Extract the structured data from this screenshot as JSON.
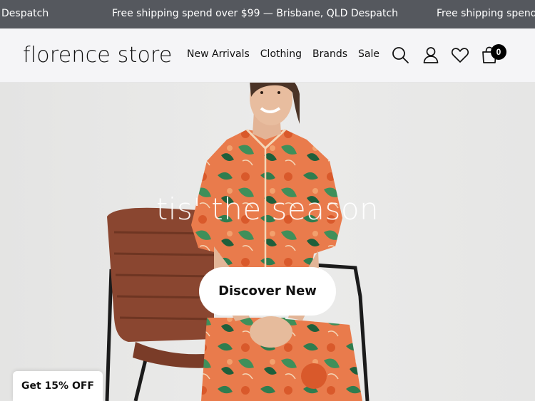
{
  "announcement": {
    "segment_left": "Despatch",
    "segment_main": "Free shipping spend over $99 — Brisbane, QLD Despatch",
    "segment_right": "Free shipping spend o"
  },
  "header": {
    "logo": "florence store",
    "nav": [
      "New Arrivals",
      "Clothing",
      "Brands",
      "Sale"
    ],
    "icons": [
      "search-icon",
      "account-icon",
      "wishlist-heart-icon",
      "cart-bag-icon"
    ],
    "cart_count": "0"
  },
  "hero": {
    "heading": "tis' the season",
    "cta_label": "Discover New"
  },
  "promo": {
    "label": "Get 15% OFF"
  },
  "colors": {
    "announcement_bg": "#55585e",
    "header_bg": "#f5f5f7",
    "hero_bg": "#e8e8e7",
    "pajama_orange": "#e7774a",
    "leaf_green": "#2f7d4f",
    "chair_leather": "#8a4630"
  }
}
